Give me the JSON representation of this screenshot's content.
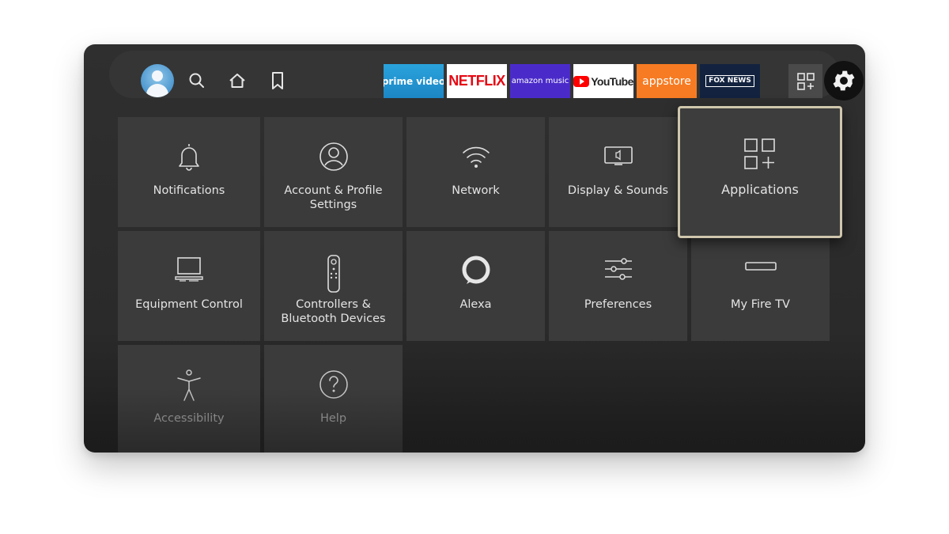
{
  "topbar": {
    "profile_icon": "avatar-icon",
    "nav_icons": [
      "search-icon",
      "home-icon",
      "bookmark-icon"
    ],
    "apps": [
      {
        "name": "prime video",
        "color": "#1f8fcf"
      },
      {
        "name": "NETFLIX",
        "color": "#e50914"
      },
      {
        "name": "amazon music",
        "color": "#4a2bc9"
      },
      {
        "name": "YouTube",
        "color": "#ff0000"
      },
      {
        "name": "appstore",
        "color": "#f77b22"
      },
      {
        "name": "FOX NEWS",
        "color": "#13233f"
      }
    ],
    "more_apps_icon": "apps-grid-plus-icon",
    "settings_icon": "gear-icon"
  },
  "settings_tiles": [
    {
      "label": "Notifications",
      "icon": "bell-icon"
    },
    {
      "label": "Account & Profile Settings",
      "icon": "account-icon"
    },
    {
      "label": "Network",
      "icon": "wifi-icon"
    },
    {
      "label": "Display & Sounds",
      "icon": "display-sound-icon"
    },
    {
      "label": "Applications",
      "icon": "apps-grid-plus-icon",
      "focused": true
    },
    {
      "label": "Equipment Control",
      "icon": "tv-equipment-icon"
    },
    {
      "label": "Controllers & Bluetooth Devices",
      "icon": "remote-icon"
    },
    {
      "label": "Alexa",
      "icon": "alexa-ring-icon"
    },
    {
      "label": "Preferences",
      "icon": "sliders-icon"
    },
    {
      "label": "My Fire TV",
      "icon": "fire-tv-stick-icon"
    },
    {
      "label": "Accessibility",
      "icon": "accessibility-icon"
    },
    {
      "label": "Help",
      "icon": "help-icon"
    }
  ],
  "colors": {
    "background": "#2c2c2c",
    "tile": "#3b3b3b",
    "focus_border": "#cfc6ad"
  }
}
